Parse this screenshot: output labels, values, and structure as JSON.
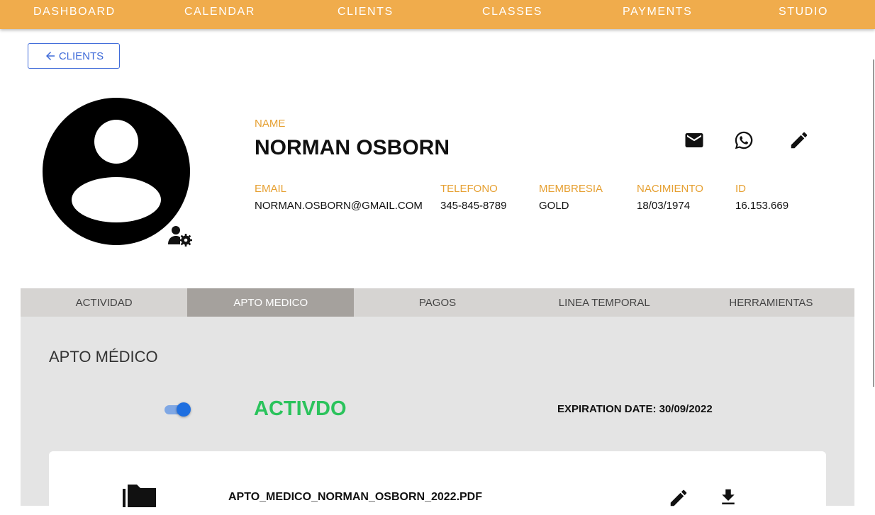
{
  "nav": {
    "items": [
      {
        "label": "DASHBOARD"
      },
      {
        "label": "CALENDAR"
      },
      {
        "label": "CLIENTS"
      },
      {
        "label": "CLASSES"
      },
      {
        "label": "PAYMENTS"
      },
      {
        "label": "STUDIO"
      }
    ]
  },
  "back_button": {
    "label": "CLIENTS",
    "icon": "arrow-left-icon"
  },
  "profile": {
    "name_label": "NAME",
    "name": "NORMAN OSBORN",
    "fields": [
      {
        "label": "EMAIL",
        "value": "NORMAN.OSBORN@GMAIL.COM"
      },
      {
        "label": "TELEFONO",
        "value": "345-845-8789"
      },
      {
        "label": "MEMBRESIA",
        "value": "GOLD"
      },
      {
        "label": "NACIMIENTO",
        "value": "18/03/1974"
      },
      {
        "label": "ID",
        "value": "16.153.669"
      }
    ],
    "actions": [
      "mail-icon",
      "whatsapp-icon",
      "edit-icon"
    ]
  },
  "tabs": [
    {
      "label": "ACTIVIDAD",
      "active": false
    },
    {
      "label": "APTO MEDICO",
      "active": true
    },
    {
      "label": "PAGOS",
      "active": false
    },
    {
      "label": "LINEA TEMPORAL",
      "active": false
    },
    {
      "label": "HERRAMIENTAS",
      "active": false
    }
  ],
  "apto_medico": {
    "title": "APTO MÉDICO",
    "toggle_on": true,
    "status": "ACTIVDO",
    "expiration": "EXPIRATION DATE: 30/09/2022",
    "file": {
      "name": "APTO_MEDICO_NORMAN_OSBORN_2022.PDF",
      "icons": [
        "folder-icon",
        "edit-icon",
        "download-icon"
      ]
    }
  },
  "colors": {
    "nav_bg": "#f0ac4c",
    "label": "#e6a032",
    "accent_blue": "#3f6bd9",
    "status_green": "#2bc35c",
    "tab_active": "#a5a19d",
    "panel_bg": "#e4e4e4"
  }
}
